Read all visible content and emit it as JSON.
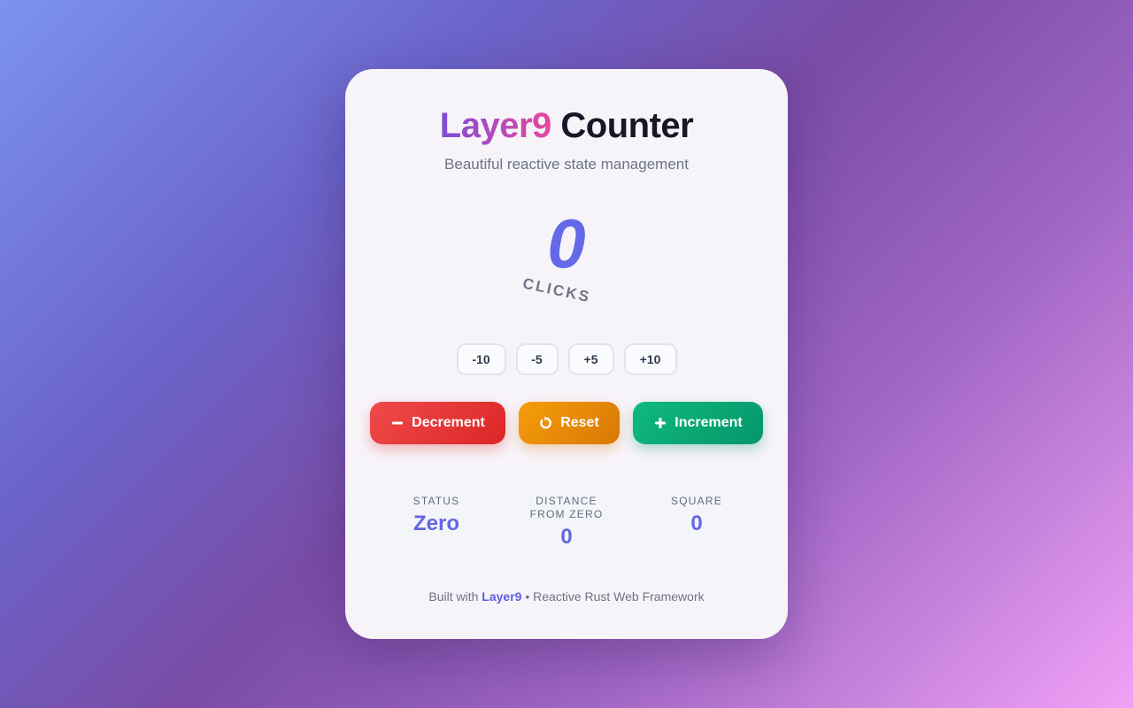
{
  "header": {
    "brand": "Layer9",
    "title_rest": "Counter",
    "subtitle": "Beautiful reactive state management"
  },
  "counter": {
    "value": "0",
    "label": "CLICKS"
  },
  "quick_adjust": [
    {
      "label": "-10"
    },
    {
      "label": "-5"
    },
    {
      "label": "+5"
    },
    {
      "label": "+10"
    }
  ],
  "actions": {
    "decrement": {
      "label": "Decrement",
      "icon": "minus-icon",
      "color": "#dc2626"
    },
    "reset": {
      "label": "Reset",
      "icon": "reset-icon",
      "color": "#d97706"
    },
    "increment": {
      "label": "Increment",
      "icon": "plus-icon",
      "color": "#059669"
    }
  },
  "stats": [
    {
      "label": "STATUS",
      "value": "Zero"
    },
    {
      "label": "DISTANCE FROM ZERO",
      "value": "0"
    },
    {
      "label": "SQUARE",
      "value": "0"
    }
  ],
  "footer": {
    "prefix": "Built with",
    "brand": "Layer9",
    "separator": "•",
    "suffix": "Reactive Rust Web Framework"
  },
  "colors": {
    "accent": "#6366e3",
    "text_dark": "#161827",
    "muted": "#6b7487"
  }
}
